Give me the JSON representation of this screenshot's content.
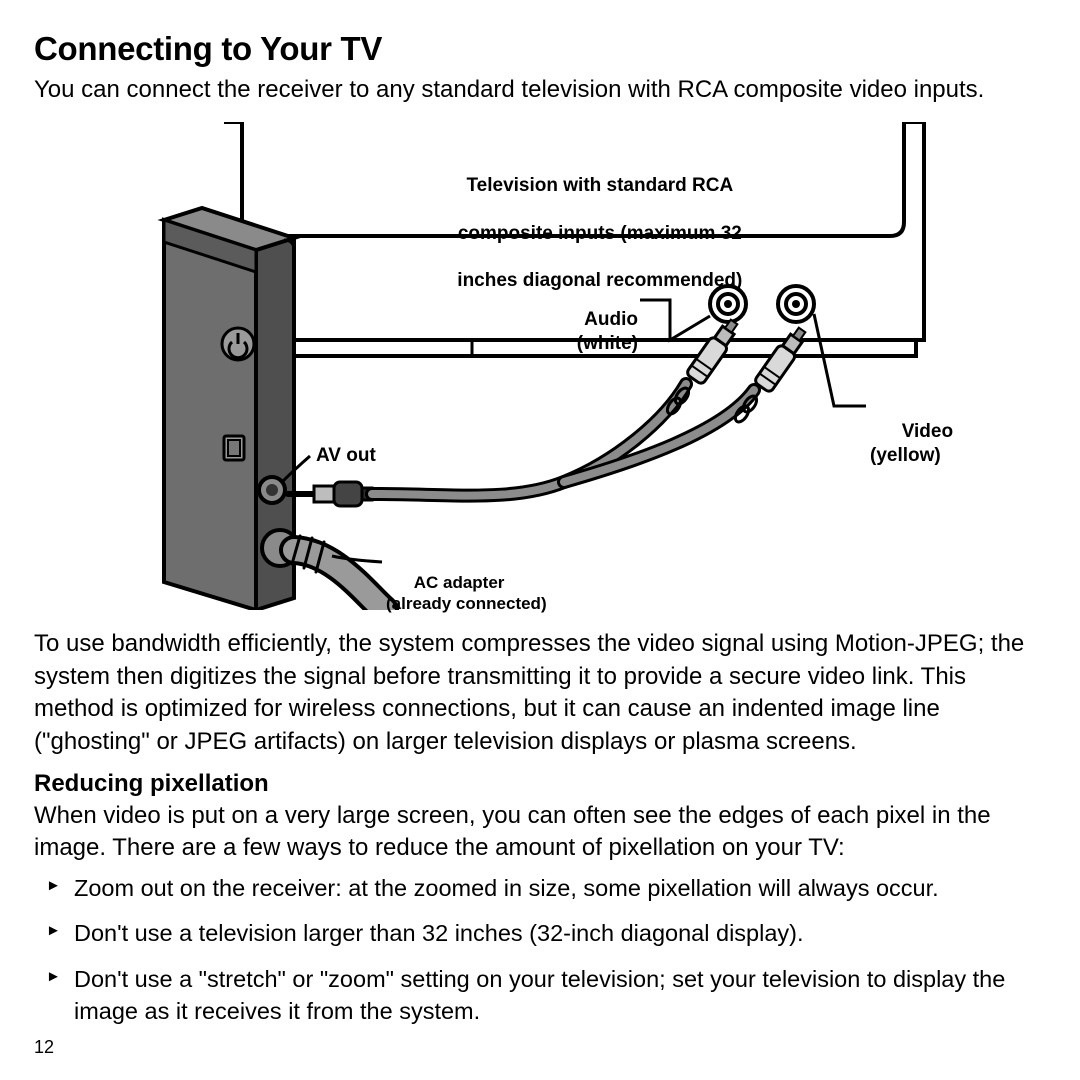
{
  "heading": "Connecting to Your TV",
  "intro": "You can connect the receiver to any standard television with RCA composite video inputs.",
  "figure": {
    "tv_caption_l1": "Television with standard RCA",
    "tv_caption_l2": "composite inputs (maximum 32",
    "tv_caption_l3": "inches diagonal recommended)",
    "audio_l1": "Audio",
    "audio_l2": "(white)",
    "video_l1": "Video",
    "video_l2": "(yellow)",
    "avout": "AV out",
    "ac_l1": "AC adapter",
    "ac_l2": "(already connected)"
  },
  "paragraph2": "To use bandwidth efficiently, the system compresses the video signal using Motion-JPEG; the system then digitizes the signal before transmitting it to provide a secure video link. This method is optimized for wireless connections, but it can cause an indented image line (\"ghosting\" or JPEG artifacts) on larger television displays or plasma screens.",
  "subheading": "Reducing pixellation",
  "sub_intro": "When video is put on a very large screen, you can often see the edges of each pixel in the image. There are a few ways to reduce the amount of pixellation on your TV:",
  "bullets": [
    "Zoom out on the receiver: at the zoomed in size, some pixellation will always occur.",
    "Don't use a television larger than 32 inches (32-inch diagonal display).",
    "Don't use a \"stretch\" or \"zoom\" setting on your television; set your television to display the image as it receives it from the system."
  ],
  "page_number": "12"
}
